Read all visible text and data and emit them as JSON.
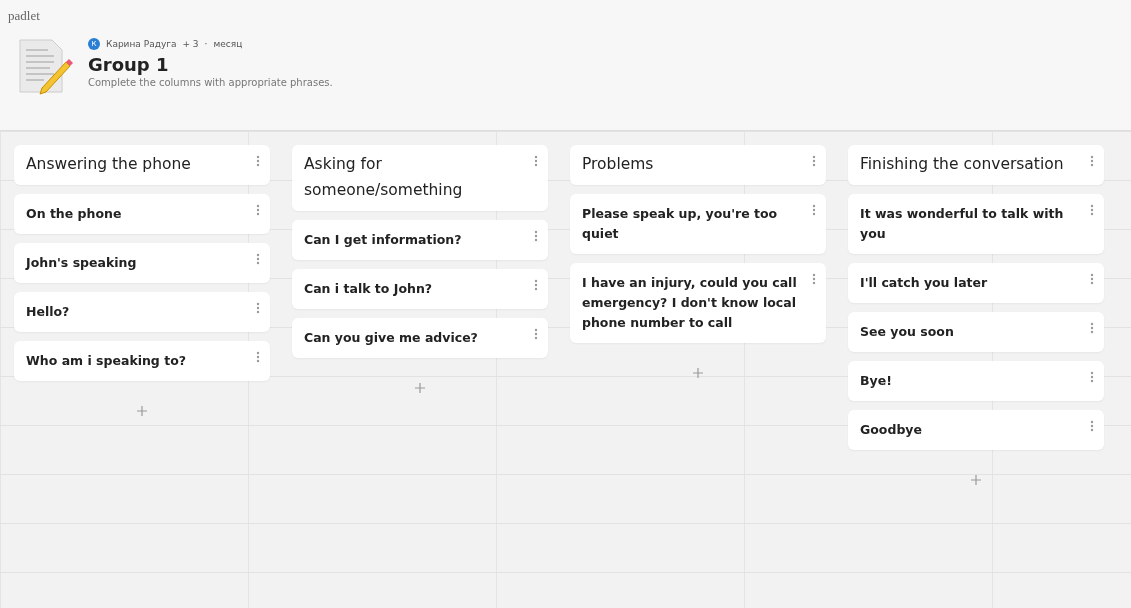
{
  "brand": "padlet",
  "header": {
    "avatar_letter": "К",
    "author": "Карина Радуга",
    "contributors": "+ 3",
    "separator": "·",
    "time": "месяц",
    "title": "Group 1",
    "description": "Complete the columns with appropriate phrases."
  },
  "columns": [
    {
      "title": "Answering the phone",
      "posts": [
        "On the phone",
        "John's speaking",
        "Hello?",
        "Who am i speaking to?"
      ]
    },
    {
      "title": "Asking for someone/something",
      "posts": [
        "Can I get information?",
        "Can i talk to John?",
        "Can you give me advice?"
      ]
    },
    {
      "title": "Problems",
      "posts": [
        "Please speak up, you're too quiet",
        "I have an injury, could you call emergency? I don't know local phone number to call"
      ]
    },
    {
      "title": "Finishing the conversation",
      "posts": [
        "It was wonderful to talk with you",
        "I'll catch you later",
        "See you soon",
        "Bye!",
        "Goodbye"
      ]
    }
  ]
}
